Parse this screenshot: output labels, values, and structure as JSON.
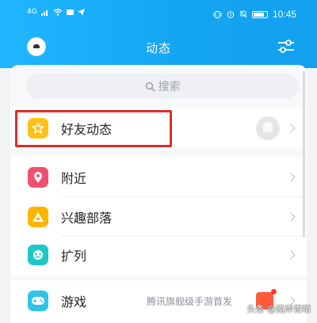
{
  "status_bar": {
    "signal": "4G",
    "time": "10:45"
  },
  "header": {
    "title": "动态"
  },
  "search": {
    "placeholder": "搜索"
  },
  "items": [
    {
      "label": "好友动态",
      "icon": "star-icon",
      "color": "#ffc019"
    },
    {
      "label": "附近",
      "icon": "location-pin-icon",
      "color": "#f0506e"
    },
    {
      "label": "兴趣部落",
      "icon": "triangle-icon",
      "color": "#ffb400"
    },
    {
      "label": "扩列",
      "icon": "bubble-icon",
      "color": "#1ec8c8"
    }
  ],
  "game": {
    "label": "游戏",
    "subtitle": "腾讯旗舰级手游首发",
    "icon": "gamepad-icon",
    "color": "#2fc4e8"
  },
  "watermark": "头条 @南岸青晴",
  "colors": {
    "header": "#1aaef7",
    "highlight": "#e32a2a"
  }
}
